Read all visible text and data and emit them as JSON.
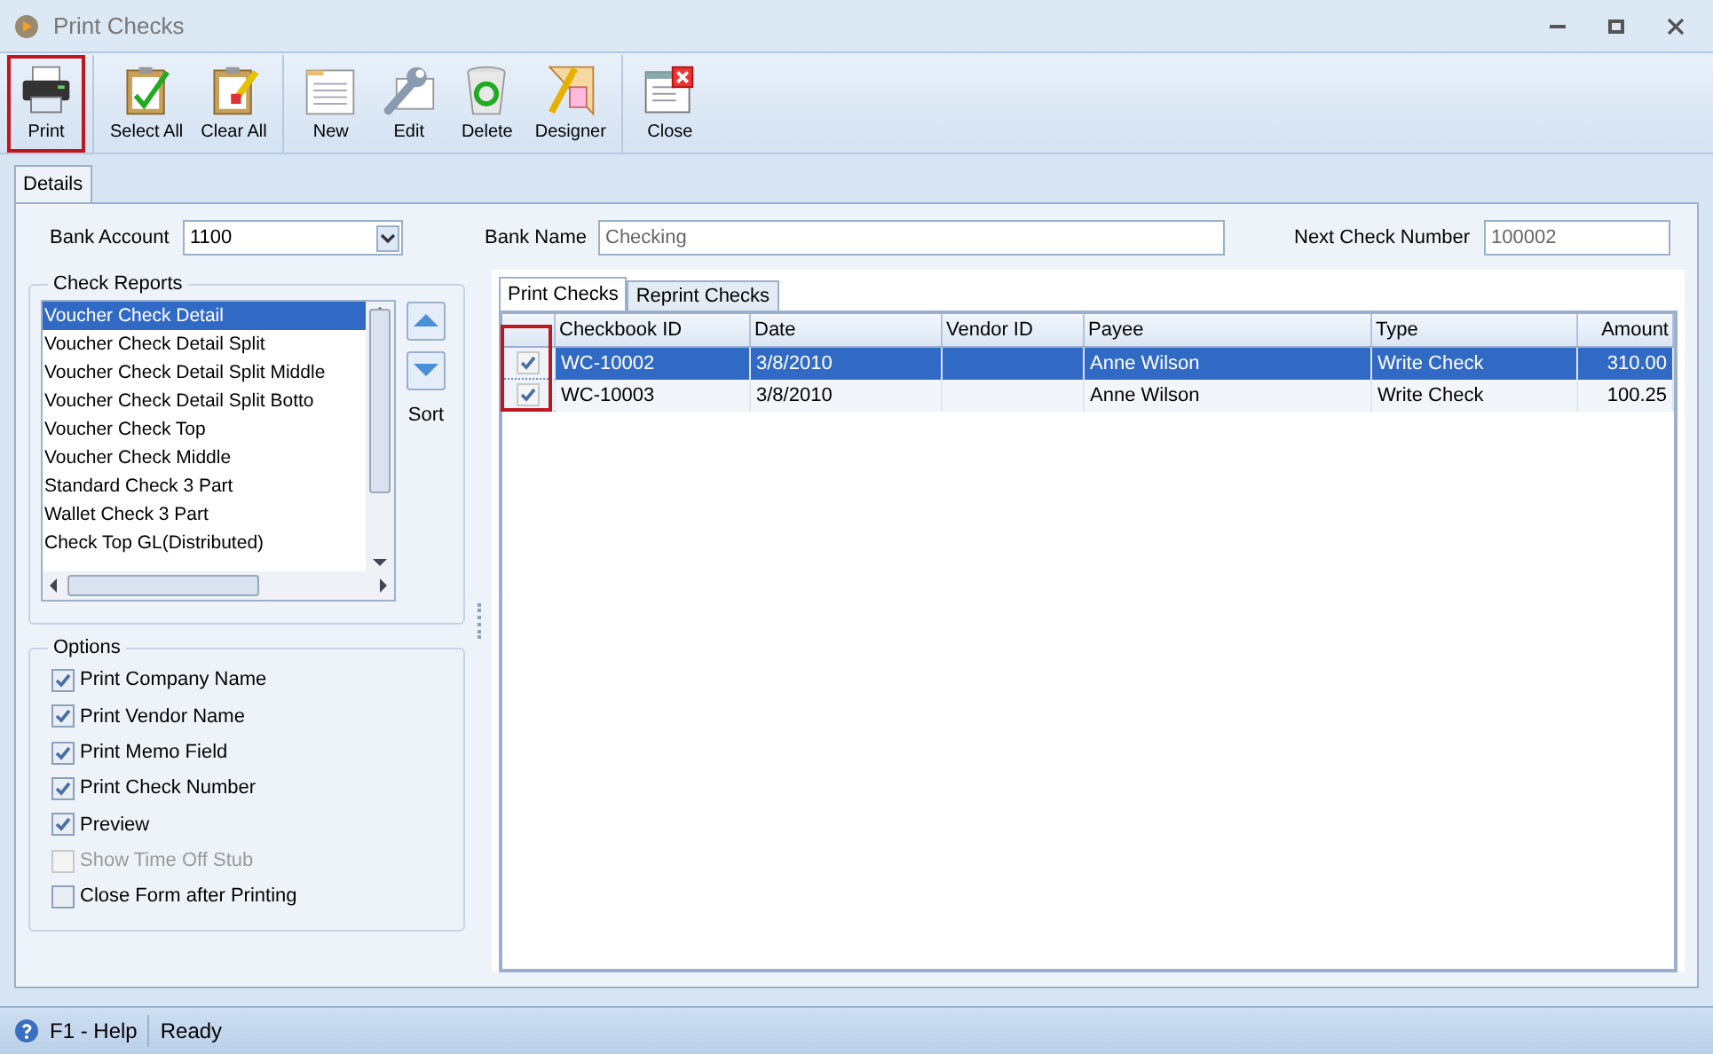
{
  "window": {
    "title": "Print Checks"
  },
  "toolbar": [
    [
      {
        "label": "Print",
        "highlighted": true
      }
    ],
    [
      {
        "label": "Select All",
        "highlighted": false
      },
      {
        "label": "Clear All",
        "highlighted": false
      }
    ],
    [
      {
        "label": "New",
        "highlighted": false
      },
      {
        "label": "Edit",
        "highlighted": false
      },
      {
        "label": "Delete",
        "highlighted": false
      },
      {
        "label": "Designer",
        "highlighted": false
      }
    ],
    [
      {
        "label": "Close",
        "highlighted": false
      }
    ]
  ],
  "tabs": [
    {
      "label": "Details",
      "selected": true
    }
  ],
  "bank_account": {
    "label": "Bank Account",
    "value": "1100"
  },
  "bank_name": {
    "label": "Bank Name",
    "value": "Checking"
  },
  "next_check_number": {
    "label": "Next Check Number",
    "value": "100002"
  },
  "check_reports": {
    "title": "Check Reports",
    "sort_label": "Sort",
    "items": [
      {
        "label": "Voucher Check Detail",
        "selected": true
      },
      {
        "label": "Voucher Check Detail Split",
        "selected": false
      },
      {
        "label": "Voucher Check Detail Split Middle",
        "selected": false
      },
      {
        "label": "Voucher Check Detail Split Botto",
        "selected": false
      },
      {
        "label": "Voucher Check Top",
        "selected": false
      },
      {
        "label": "Voucher Check Middle",
        "selected": false
      },
      {
        "label": "Standard Check 3 Part",
        "selected": false
      },
      {
        "label": "Wallet Check 3 Part",
        "selected": false
      },
      {
        "label": "Check Top GL(Distributed)",
        "selected": false
      }
    ]
  },
  "options": {
    "title": "Options",
    "items": [
      {
        "label": "Print Company Name",
        "checked": true,
        "disabled": false
      },
      {
        "label": "Print Vendor Name",
        "checked": true,
        "disabled": false
      },
      {
        "label": "Print Memo Field",
        "checked": true,
        "disabled": false
      },
      {
        "label": "Print Check Number",
        "checked": true,
        "disabled": false
      },
      {
        "label": "Preview",
        "checked": true,
        "disabled": false
      },
      {
        "label": "Show Time Off Stub",
        "checked": false,
        "disabled": true
      },
      {
        "label": "Close Form after Printing",
        "checked": false,
        "disabled": false
      }
    ]
  },
  "grid_tabs": [
    {
      "label": "Print Checks",
      "selected": true
    },
    {
      "label": "Reprint Checks",
      "selected": false
    }
  ],
  "table": {
    "check_column_highlighted": true,
    "columns": [
      "Checkbook ID",
      "Date",
      "Vendor ID",
      "Payee",
      "Type",
      "Amount"
    ],
    "rows": [
      {
        "checked": true,
        "selected": true,
        "cells": [
          "WC-10002",
          "3/8/2010",
          "",
          "Anne Wilson",
          "Write Check",
          "310.00"
        ]
      },
      {
        "checked": true,
        "selected": false,
        "cells": [
          "WC-10003",
          "3/8/2010",
          "",
          "Anne Wilson",
          "Write Check",
          "100.25"
        ]
      }
    ]
  },
  "status_bar": {
    "help": "F1 - Help",
    "status": "Ready"
  }
}
